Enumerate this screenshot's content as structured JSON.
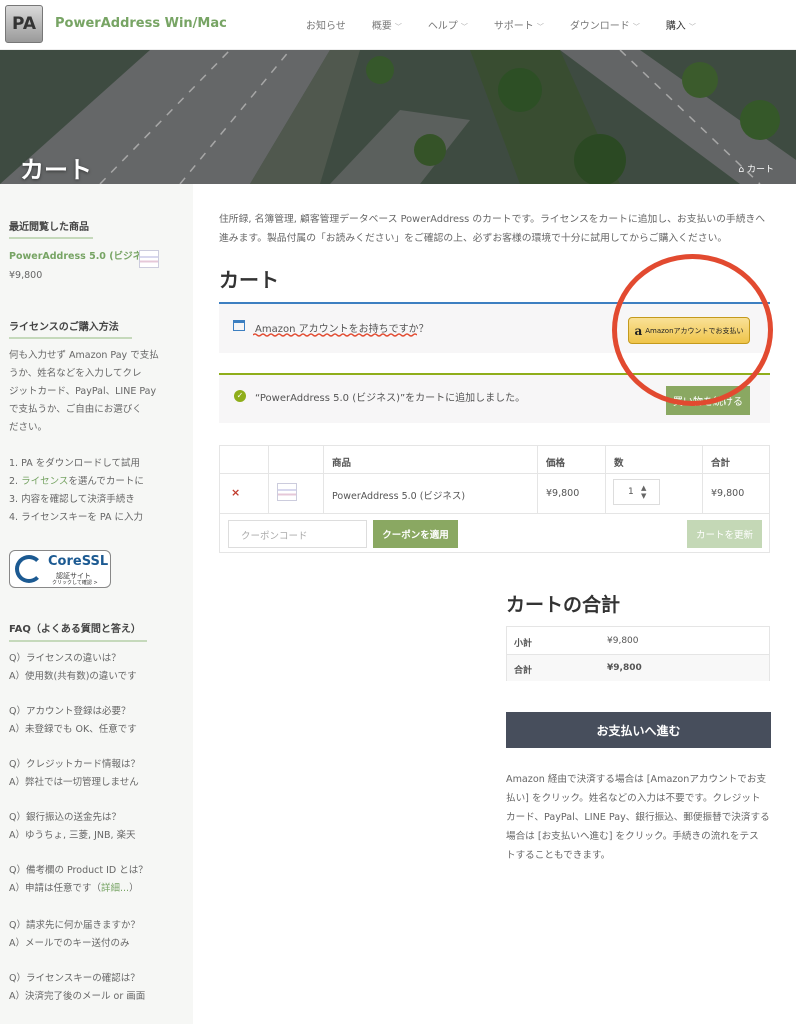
{
  "header": {
    "logo_text": "PA",
    "site_title": "PowerAddress Win/Mac",
    "nav": [
      {
        "label": "お知らせ",
        "has_dropdown": false
      },
      {
        "label": "概要",
        "has_dropdown": true
      },
      {
        "label": "ヘルプ",
        "has_dropdown": true
      },
      {
        "label": "サポート",
        "has_dropdown": true
      },
      {
        "label": "ダウンロード",
        "has_dropdown": true
      },
      {
        "label": "購入",
        "has_dropdown": true
      }
    ]
  },
  "hero": {
    "title": "カート",
    "breadcrumb": "カート",
    "breadcrumb_icon": "home-icon"
  },
  "sidebar": {
    "recent_heading": "最近閲覧した商品",
    "recent_item_name": "PowerAddress 5.0 (ビジネス)",
    "recent_item_price": "¥9,800",
    "howto_heading": "ライセンスのご購入方法",
    "howto_lines": [
      "何も入力せず Amazon Pay で支払",
      "うか、姓名などを入力してクレ",
      "ジットカード、PayPal、LINE Pay",
      "で支払うか、ご自由にお選びく",
      "ださい。"
    ],
    "steps": [
      {
        "pre": "1. PA をダウンロードして試用",
        "link": "",
        "post": ""
      },
      {
        "pre": "2. ",
        "link": "ライセンス",
        "post": "を選んでカートに"
      },
      {
        "pre": "3. 内容を確認して決済手続き",
        "link": "",
        "post": ""
      },
      {
        "pre": "4. ライセンスキーを PA に入力",
        "link": "",
        "post": ""
      }
    ],
    "ssl_title": "CoreSSL",
    "ssl_sub": "認証サイト",
    "ssl_hint": "クリックして確認 >",
    "faq_heading": "FAQ（よくある質問と答え）",
    "faq": [
      {
        "q": "Q）ライセンスの違いは？",
        "a": "A）使用数(共有数)の違いです",
        "link": ""
      },
      {
        "q": "Q）アカウント登録は必要？",
        "a": "A）未登録でも OK、任意です",
        "link": ""
      },
      {
        "q": "Q）クレジットカード情報は？",
        "a": "A）弊社では一切管理しません",
        "link": ""
      },
      {
        "q": "Q）銀行振込の送金先は？",
        "a": "A）ゆうちょ, 三菱, JNB, 楽天",
        "link": ""
      },
      {
        "q": "Q）備考欄の Product ID とは？",
        "a": "A）申請は任意です（",
        "link": "詳細...",
        "tail": "）"
      },
      {
        "q": "Q）請求先に何か届きますか？",
        "a": "A）メールでのキー送付のみ",
        "link": ""
      },
      {
        "q": "Q）ライセンスキーの確認は？",
        "a": "A）決済完了後のメール or 画面",
        "link": ""
      }
    ]
  },
  "main": {
    "intro_lines": [
      "住所録, 名簿管理, 顧客管理データベース PowerAddress のカートです。ライセンスをカートに追加し、お支払いの手続きへ",
      "進みます。製品付属の「お読みください」をご確認の上、必ずお客様の環境で十分に試用してからご購入ください。"
    ],
    "cart_heading": "カート",
    "amazon_notice": "Amazon アカウントをお持ちですか？",
    "amazon_button": "Amazonアカウントでお支払い",
    "amazon_logo_letter": "a",
    "added_notice": "“PowerAddress 5.0 (ビジネス)”をカートに追加しました。",
    "continue_button": "買い物を続ける",
    "table": {
      "headers": {
        "product": "商品",
        "price": "価格",
        "qty": "数",
        "total": "合計"
      },
      "row": {
        "remove": "×",
        "product": "PowerAddress 5.0 (ビジネス)",
        "price": "¥9,800",
        "qty": "1",
        "total": "¥9,800"
      }
    },
    "coupon_placeholder": "クーポンコード",
    "coupon_button": "クーポンを適用",
    "update_button": "カートを更新",
    "totals_heading": "カートの合計",
    "subtotal_label": "小計",
    "subtotal_value": "¥9,800",
    "total_label": "合計",
    "total_value": "¥9,800",
    "checkout_button": "お支払いへ進む",
    "note_lines": [
      "Amazon 経由で決済する場合は [Amazonアカウントでお支",
      "払い] をクリック。姓名などの入力は不要です。クレジット",
      "カード、PayPal、LINE Pay、銀行振込、郵便振替で決済する",
      "場合は [お支払いへ進む] をクリック。手続きの流れをテス",
      "トすることもできます。"
    ]
  },
  "colors": {
    "accent_green": "#77a464",
    "button_green": "#8aa862",
    "notice_blue": "#3d7fc1",
    "annotation_red": "#e24a30",
    "checkout_dark": "#474e5c"
  }
}
